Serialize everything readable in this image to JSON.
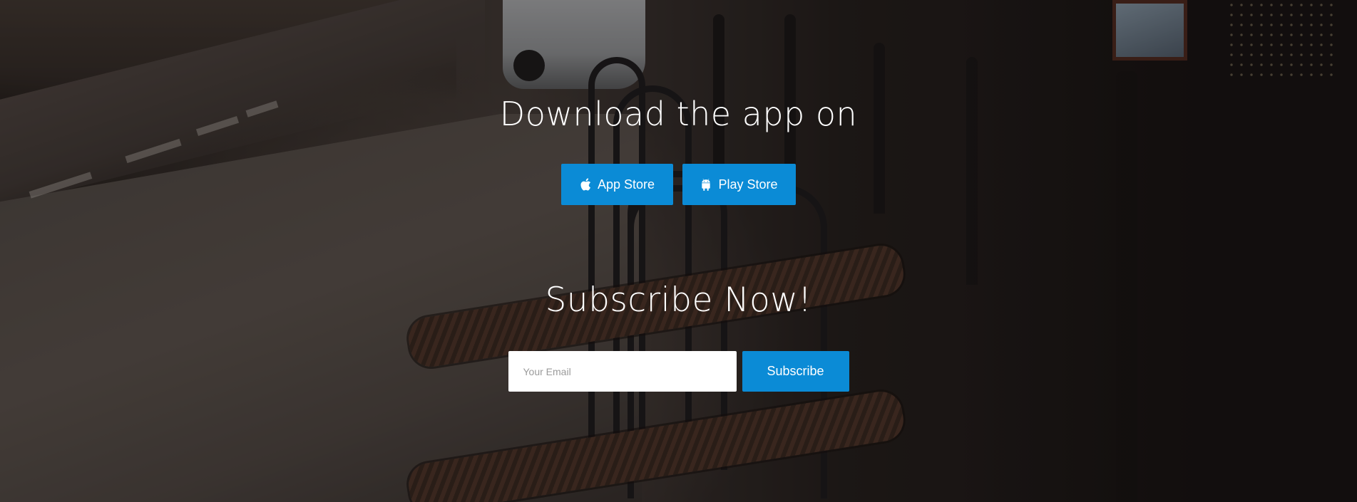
{
  "download": {
    "title": "Download the app on",
    "buttons": [
      {
        "label": "App Store",
        "icon": "apple-icon"
      },
      {
        "label": "Play Store",
        "icon": "android-icon"
      }
    ]
  },
  "subscribe": {
    "title": "Subscribe Now!",
    "email_placeholder": "Your Email",
    "email_value": "",
    "button_label": "Subscribe"
  },
  "colors": {
    "accent": "#0b8bd6",
    "text": "#ffffff",
    "input_bg": "#ffffff",
    "overlay": "#120e0d"
  }
}
